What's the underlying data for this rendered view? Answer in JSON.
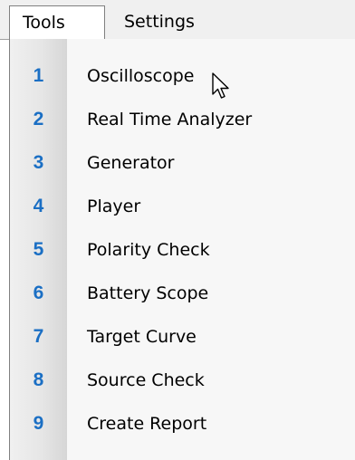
{
  "menubar": {
    "tabs": [
      {
        "label": "Tools",
        "active": true
      },
      {
        "label": "Settings",
        "active": false
      }
    ]
  },
  "tools_menu": {
    "items": [
      {
        "number": "1",
        "label": "Oscilloscope"
      },
      {
        "number": "2",
        "label": "Real Time Analyzer"
      },
      {
        "number": "3",
        "label": "Generator"
      },
      {
        "number": "4",
        "label": "Player"
      },
      {
        "number": "5",
        "label": "Polarity Check"
      },
      {
        "number": "6",
        "label": "Battery Scope"
      },
      {
        "number": "7",
        "label": "Target Curve"
      },
      {
        "number": "8",
        "label": "Source Check"
      },
      {
        "number": "9",
        "label": "Create Report"
      }
    ]
  },
  "icons": {
    "cursor": "mouse-pointer-icon"
  },
  "colors": {
    "number_accent": "#1b6fc4",
    "menu_background": "#f7f7f7",
    "menubar_background": "#f0f0f0"
  }
}
